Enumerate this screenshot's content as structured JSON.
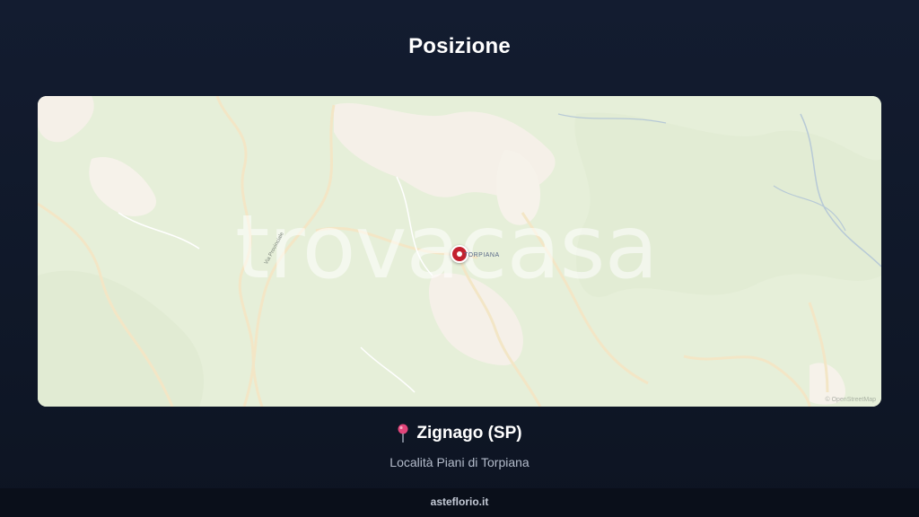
{
  "page": {
    "title": "Posizione"
  },
  "map": {
    "marker_label": "TORPIANA",
    "road_label": "Via Provinciale",
    "watermark": "trovacasa",
    "attribution": "© OpenStreetMap"
  },
  "location": {
    "icon": "map-pin-icon",
    "name": "Zignago (SP)",
    "detail": "Località Piani di Torpiana"
  },
  "footer": {
    "site": "asteflorio.it"
  },
  "colors": {
    "background": "#111a2c",
    "map_green": "#e7f0da",
    "pin_red": "#c3202f"
  }
}
